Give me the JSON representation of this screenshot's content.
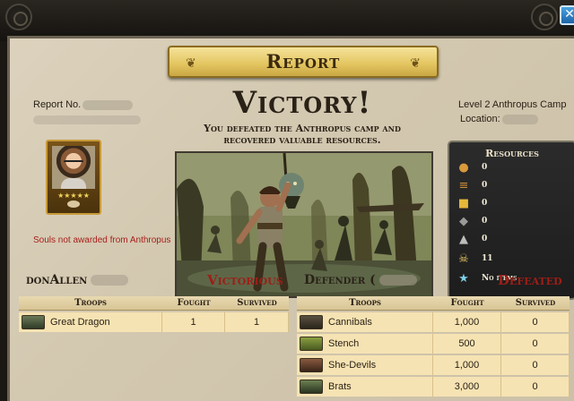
{
  "window": {
    "title": "Report"
  },
  "header": {
    "victory": "Victory!",
    "subtitle": "You defeated the Anthropus camp and recovered valuable resources.",
    "report_no_label": "Report No.",
    "camp": "Level 2 Anthropus Camp",
    "location_label": "Location:"
  },
  "player": {
    "souls_note": "Souls not awarded from Anthropus",
    "rank_stars": "★★★★★"
  },
  "resources": {
    "title": "Resources",
    "items": [
      {
        "icon": "food-icon",
        "value": "0",
        "color": "#d99a3a"
      },
      {
        "icon": "wood-icon",
        "value": "0",
        "color": "#c78c3b"
      },
      {
        "icon": "gold-icon",
        "value": "0",
        "color": "#e6b83a"
      },
      {
        "icon": "ore-icon",
        "value": "0",
        "color": "#9a9a9a"
      },
      {
        "icon": "stone-icon",
        "value": "0",
        "color": "#bdbdbd"
      },
      {
        "icon": "souls-skull-icon",
        "value": "11",
        "color": "#e0c060"
      },
      {
        "icon": "item-star-icon",
        "value": "No items",
        "color": "#7fd0e8"
      }
    ]
  },
  "attacker": {
    "name": "donAllen",
    "result": "Victorious",
    "headers": [
      "Troops",
      "Fought",
      "Survived"
    ],
    "rows": [
      {
        "name": "Great Dragon",
        "fought": "1",
        "survived": "1"
      }
    ]
  },
  "defender": {
    "name": "Defender (",
    "result": "Defeated",
    "headers": [
      "Troops",
      "Fought",
      "Survived"
    ],
    "rows": [
      {
        "name": "Cannibals",
        "fought": "1,000",
        "survived": "0"
      },
      {
        "name": "Stench",
        "fought": "500",
        "survived": "0"
      },
      {
        "name": "She-Devils",
        "fought": "1,000",
        "survived": "0"
      },
      {
        "name": "Brats",
        "fought": "3,000",
        "survived": "0"
      }
    ]
  },
  "colors": {
    "accent_red": "#9e1e17",
    "banner_gold": "#e2c45f",
    "parchment": "#d6cbb3",
    "resources_bg": "#222222"
  }
}
